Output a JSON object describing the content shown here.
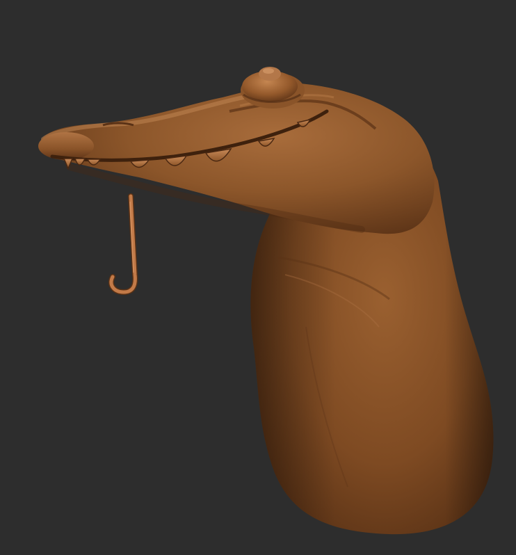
{
  "scene": {
    "subject": "crocodile-sculpt",
    "background_color": "#2d2d2d",
    "material_base_color": "#8b5429",
    "material_highlight_color": "#b5794a",
    "material_shadow_color": "#4a2812",
    "hook_color": "#c27a48",
    "icons": [
      "crocodile-head",
      "teeth",
      "eye",
      "hook"
    ]
  }
}
